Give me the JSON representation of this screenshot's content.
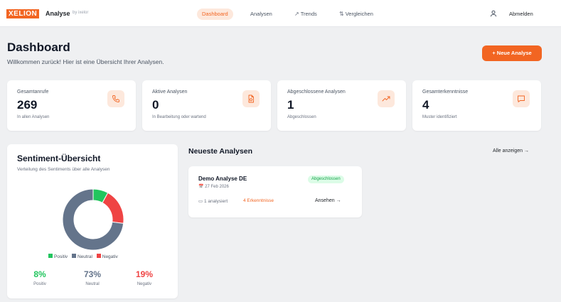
{
  "brand": {
    "logo": "XELION",
    "name": "Analyse",
    "byline": "by ixelor",
    "accent_color": "#f26522"
  },
  "nav": {
    "dashboard": "Dashboard",
    "analysen": "Analysen",
    "trends": "Trends",
    "vergleichen": "Vergleichen",
    "logout": "Abmelden",
    "active": "dashboard"
  },
  "header": {
    "title": "Dashboard",
    "subtitle": "Willkommen zurück! Hier ist eine Übersicht Ihrer Analysen.",
    "new_button": "+ Neue Analyse"
  },
  "stats": [
    {
      "label": "Gesamtanrufe",
      "value": "269",
      "desc": "In allen Analysen",
      "icon": "phone-icon"
    },
    {
      "label": "Aktive Analysen",
      "value": "0",
      "desc": "In Bearbeitung oder wartend",
      "icon": "document-icon"
    },
    {
      "label": "Abgeschlossene Analysen",
      "value": "1",
      "desc": "Abgeschlossen",
      "icon": "trending-up-icon"
    },
    {
      "label": "Gesamterkenntnisse",
      "value": "4",
      "desc": "Muster identifiziert",
      "icon": "message-icon"
    }
  ],
  "sentiment": {
    "title": "Sentiment-Übersicht",
    "subtitle": "Verteilung des Sentiments über alle Analysen",
    "legend": [
      "Positiv",
      "Neutral",
      "Negativ"
    ],
    "colors": {
      "positiv": "#22c55e",
      "neutral": "#64748b",
      "negativ": "#ef4444"
    },
    "values": {
      "positiv": 8,
      "neutral": 73,
      "negativ": 19
    },
    "percent_labels": {
      "positiv": "8%",
      "neutral": "73%",
      "negativ": "19%"
    },
    "stat_labels": {
      "positiv": "Positiv",
      "neutral": "Neutral",
      "negativ": "Negativ"
    }
  },
  "latest": {
    "title": "Neueste Analysen",
    "show_all": "Alle anzeigen →",
    "items": [
      {
        "name": "Demo Analyse DE",
        "date": "27 Feb 2026",
        "status": "Abgeschlossen",
        "analyzed": "1 analysiert",
        "findings": "4 Erkenntnisse",
        "view": "Ansehen →"
      }
    ]
  }
}
